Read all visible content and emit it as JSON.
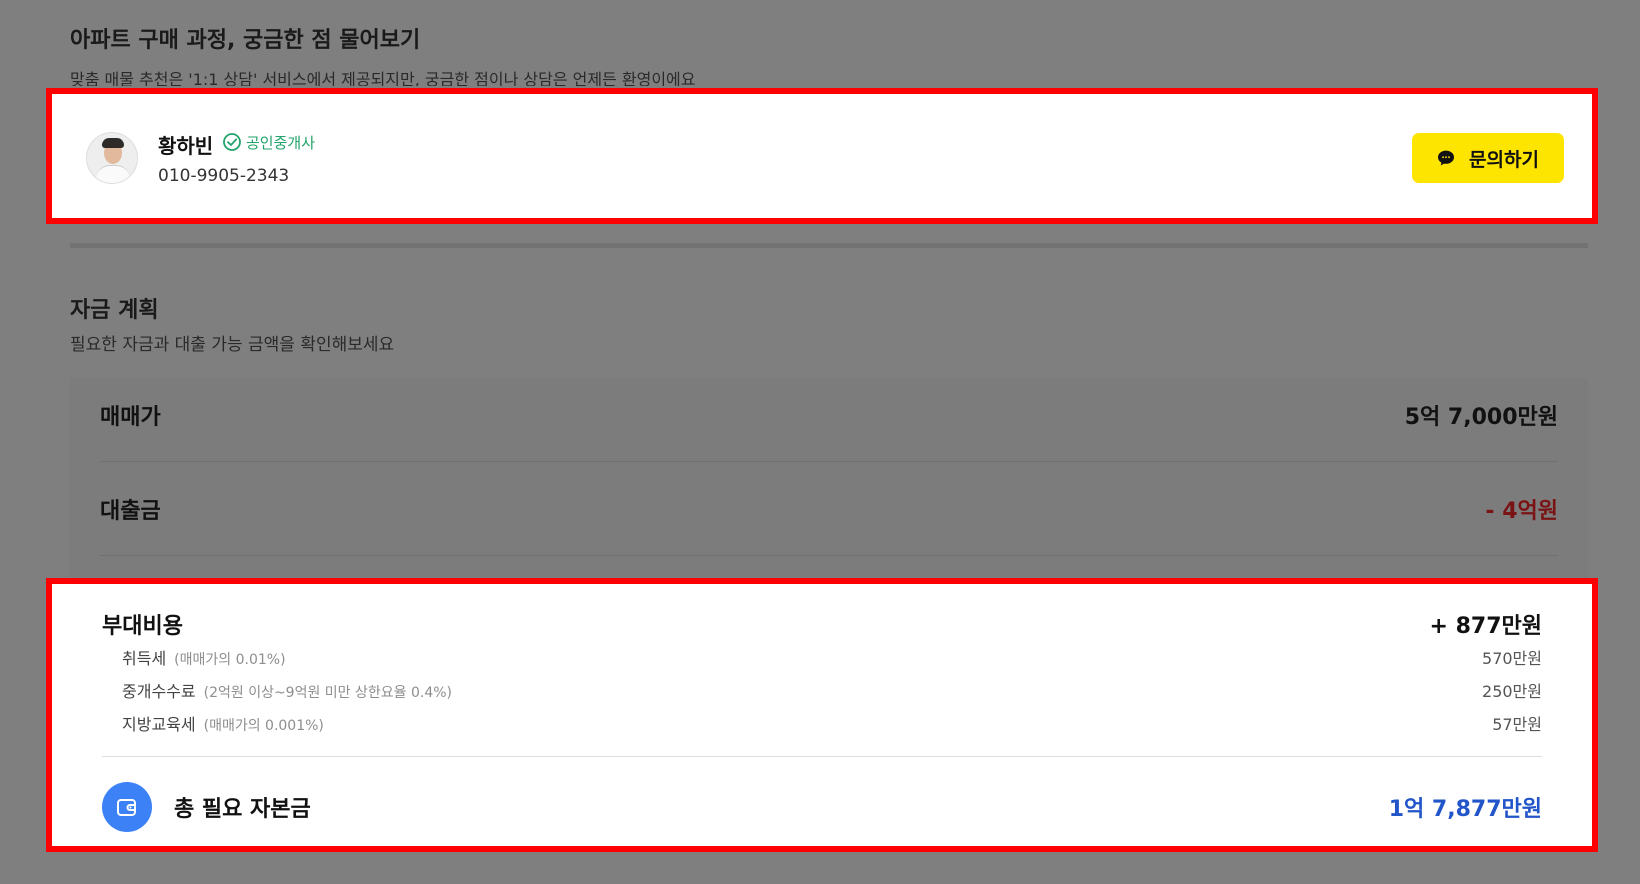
{
  "inquiry": {
    "title": "아파트 구매 과정, 궁금한 점 물어보기",
    "subtitle": "맞춤 매물 추천은 '1:1 상담' 서비스에서 제공되지만, 궁금한 점이나 상담은 언제든 환영이에요",
    "agent": {
      "name": "황하빈",
      "badge": "공인중개사",
      "phone": "010-9905-2343",
      "icon": "check-circle-icon"
    },
    "button_label": "문의하기",
    "button_icon": "kakao-chat-icon",
    "button_color": "#fee500"
  },
  "funding": {
    "title": "자금 계획",
    "subtitle": "필요한 자금과 대출 가능 금액을 확인해보세요",
    "price": {
      "label": "매매가",
      "value": "5억 7,000만원"
    },
    "loan": {
      "label": "대출금",
      "value": "- 4억원",
      "color": "#c62828"
    },
    "extra": {
      "label": "부대비용",
      "value": "+ 877만원",
      "items": [
        {
          "name": "취득세",
          "note": "(매매가의 0.01%)",
          "value": "570만원"
        },
        {
          "name": "중개수수료",
          "note": "(2억원 이상~9억원 미만 상한요율 0.4%)",
          "value": "250만원"
        },
        {
          "name": "지방교육세",
          "note": "(매매가의 0.001%)",
          "value": "57만원"
        }
      ]
    },
    "total": {
      "label": "총 필요 자본금",
      "value": "1억 7,877만원",
      "icon": "wallet-icon",
      "color": "#2255c9"
    }
  }
}
